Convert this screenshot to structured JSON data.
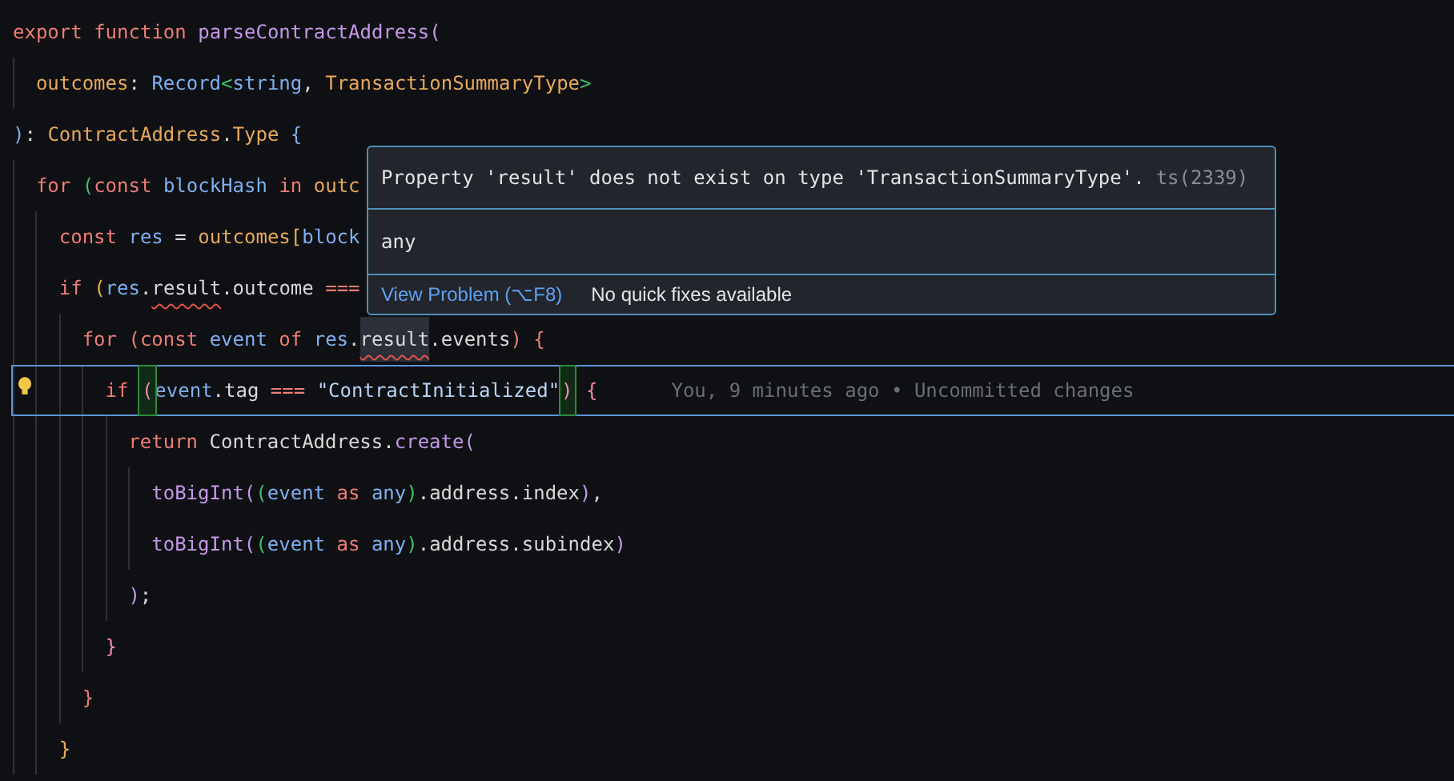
{
  "editor": {
    "lines": [
      {
        "tokens": [
          {
            "text": "export ",
            "kind": "keyword"
          },
          {
            "text": "function ",
            "kind": "keyword"
          },
          {
            "text": "parseContractAddress",
            "kind": "function"
          },
          {
            "text": "(",
            "kind": "function"
          }
        ]
      },
      {
        "tokens": [
          {
            "text": "  outcomes",
            "kind": "type"
          },
          {
            "text": ": ",
            "kind": "plain"
          },
          {
            "text": "Record",
            "kind": "variable"
          },
          {
            "text": "<",
            "kind": "bracket-green"
          },
          {
            "text": "string",
            "kind": "variable"
          },
          {
            "text": ", ",
            "kind": "plain"
          },
          {
            "text": "TransactionSummaryType",
            "kind": "type"
          },
          {
            "text": ">",
            "kind": "bracket-green"
          }
        ]
      },
      {
        "tokens": [
          {
            "text": ")",
            "kind": "variable"
          },
          {
            "text": ": ",
            "kind": "plain"
          },
          {
            "text": "ContractAddress",
            "kind": "type"
          },
          {
            "text": ".",
            "kind": "plain"
          },
          {
            "text": "Type",
            "kind": "type"
          },
          {
            "text": " {",
            "kind": "variable"
          }
        ]
      },
      {
        "tokens": [
          {
            "text": "  for ",
            "kind": "keyword"
          },
          {
            "text": "(",
            "kind": "bracket-green"
          },
          {
            "text": "const ",
            "kind": "keyword"
          },
          {
            "text": "blockHash ",
            "kind": "variable"
          },
          {
            "text": "in ",
            "kind": "keyword"
          },
          {
            "text": "outc",
            "kind": "type"
          }
        ]
      },
      {
        "tokens": [
          {
            "text": "    const ",
            "kind": "keyword"
          },
          {
            "text": "res ",
            "kind": "variable"
          },
          {
            "text": "= ",
            "kind": "plain"
          },
          {
            "text": "outcomes",
            "kind": "type"
          },
          {
            "text": "[",
            "kind": "bracket-yellow"
          },
          {
            "text": "block",
            "kind": "variable"
          }
        ]
      },
      {
        "tokens": [
          {
            "text": "    if ",
            "kind": "keyword"
          },
          {
            "text": "(",
            "kind": "bracket-yellow"
          },
          {
            "text": "res",
            "kind": "variable"
          },
          {
            "text": ".",
            "kind": "plain"
          },
          {
            "text": "result",
            "kind": "plain",
            "error": true
          },
          {
            "text": ".outcome ",
            "kind": "plain"
          },
          {
            "text": "===",
            "kind": "keyword"
          }
        ]
      },
      {
        "tokens": [
          {
            "text": "      for ",
            "kind": "keyword"
          },
          {
            "text": "(",
            "kind": "keyword"
          },
          {
            "text": "const ",
            "kind": "keyword"
          },
          {
            "text": "event ",
            "kind": "variable"
          },
          {
            "text": "of ",
            "kind": "keyword"
          },
          {
            "text": "res",
            "kind": "variable"
          },
          {
            "text": ".",
            "kind": "plain"
          },
          {
            "text": "result",
            "kind": "plain",
            "error": true,
            "highlighted": true
          },
          {
            "text": ".events",
            "kind": "plain"
          },
          {
            "text": ") ",
            "kind": "keyword"
          },
          {
            "text": "{",
            "kind": "keyword"
          }
        ]
      },
      {
        "current": true,
        "blame": "You, 9 minutes ago • Uncommitted changes",
        "tokens": [
          {
            "text": "        if ",
            "kind": "keyword"
          },
          {
            "text": "(",
            "kind": "bracket-pink",
            "matched": true
          },
          {
            "text": "event",
            "kind": "variable"
          },
          {
            "text": ".tag ",
            "kind": "plain"
          },
          {
            "text": "=== ",
            "kind": "keyword"
          },
          {
            "text": "\"ContractInitialized\"",
            "kind": "string"
          },
          {
            "text": ")",
            "kind": "bracket-pink",
            "matched": true
          },
          {
            "text": " {",
            "kind": "bracket-pink"
          }
        ]
      },
      {
        "tokens": [
          {
            "text": "          return ",
            "kind": "keyword"
          },
          {
            "text": "ContractAddress",
            "kind": "plain"
          },
          {
            "text": ".",
            "kind": "plain"
          },
          {
            "text": "create",
            "kind": "function"
          },
          {
            "text": "(",
            "kind": "function"
          }
        ]
      },
      {
        "tokens": [
          {
            "text": "            toBigInt",
            "kind": "function"
          },
          {
            "text": "(",
            "kind": "function"
          },
          {
            "text": "(",
            "kind": "bracket-green"
          },
          {
            "text": "event ",
            "kind": "variable"
          },
          {
            "text": "as ",
            "kind": "keyword"
          },
          {
            "text": "any",
            "kind": "variable"
          },
          {
            "text": ")",
            "kind": "bracket-green"
          },
          {
            "text": ".address.index",
            "kind": "plain"
          },
          {
            "text": ")",
            "kind": "function"
          },
          {
            "text": ",",
            "kind": "plain"
          }
        ]
      },
      {
        "tokens": [
          {
            "text": "            toBigInt",
            "kind": "function"
          },
          {
            "text": "(",
            "kind": "function"
          },
          {
            "text": "(",
            "kind": "bracket-green"
          },
          {
            "text": "event ",
            "kind": "variable"
          },
          {
            "text": "as ",
            "kind": "keyword"
          },
          {
            "text": "any",
            "kind": "variable"
          },
          {
            "text": ")",
            "kind": "bracket-green"
          },
          {
            "text": ".address.subindex",
            "kind": "plain"
          },
          {
            "text": ")",
            "kind": "function"
          }
        ]
      },
      {
        "tokens": [
          {
            "text": "          )",
            "kind": "function"
          },
          {
            "text": ";",
            "kind": "plain"
          }
        ]
      },
      {
        "tokens": [
          {
            "text": "        }",
            "kind": "bracket-pink"
          }
        ]
      },
      {
        "tokens": [
          {
            "text": "      }",
            "kind": "keyword"
          }
        ]
      },
      {
        "tokens": [
          {
            "text": "    }",
            "kind": "bracket-yellow"
          }
        ]
      }
    ]
  },
  "hover": {
    "message": "Property 'result' does not exist on type 'TransactionSummaryType'.",
    "code": "ts(2339)",
    "type_text": "any",
    "action": "View Problem (⌥F8)",
    "note": "No quick fixes available"
  }
}
